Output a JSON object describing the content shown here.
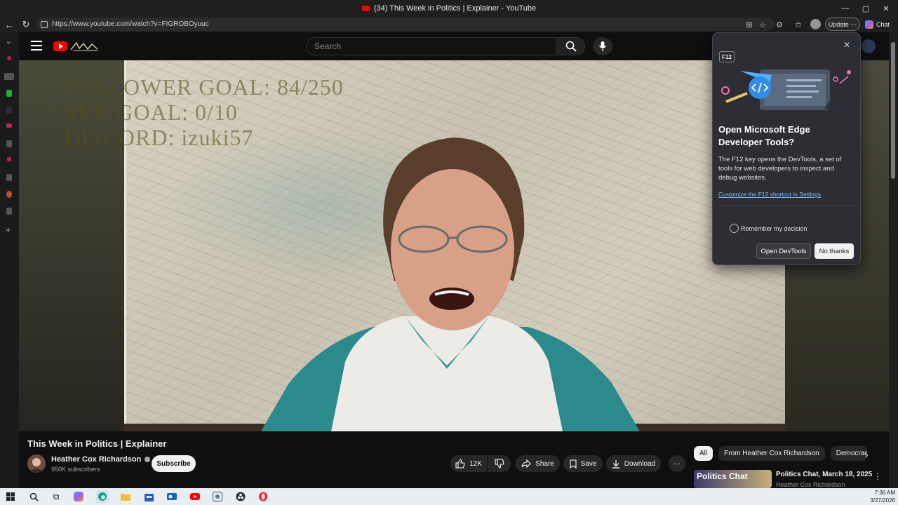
{
  "window": {
    "title": "(34) This Week in Politics | Explainer - YouTube"
  },
  "browser": {
    "url": "https://www.youtube.com/watch?v=FIGROBOyuuc",
    "update_label": "Update",
    "chat_label": "Chat",
    "more_label": "···"
  },
  "youtube": {
    "search_placeholder": "Search",
    "video": {
      "overlay_lines": [
        "FOLLOWER GOAL:  84/250",
        "SUB GOAL: 0/10",
        "DISCORD: izuki57"
      ],
      "title": "This Week in Politics | Explainer"
    },
    "channel": {
      "name": "Heather Cox Richardson",
      "subscribers": "950K subscribers",
      "subscribe_label": "Subscribe"
    },
    "actions": {
      "likes": "12K",
      "share": "Share",
      "save": "Save",
      "download": "Download",
      "more": "···"
    },
    "chips": [
      "All",
      "From Heather Cox Richardson",
      "Democracy"
    ],
    "recommended": {
      "thumb_text": "Politics Chat",
      "title": "Politics Chat, March 18, 2025",
      "channel": "Heather Cox Richardson"
    }
  },
  "devtools_popup": {
    "badge": "F12",
    "title": "Open Microsoft Edge Developer Tools?",
    "body": "The F12 key opens the DevTools, a set of tools for web developers to inspect and debug websites.",
    "link": "Customize the F12 shortcut in Settings",
    "remember_label": "Remember my decision",
    "open_label": "Open DevTools",
    "no_label": "No thanks"
  },
  "taskbar": {
    "time": "7:36 AM",
    "date": "3/27/2026"
  },
  "colors": {
    "youtube_red": "#ff0000",
    "link_blue": "#7ec0ff",
    "popup_bg": "#2d2e33"
  }
}
